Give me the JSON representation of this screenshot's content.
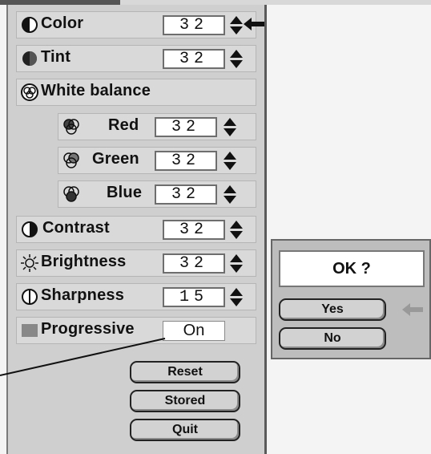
{
  "menu": {
    "color": {
      "label": "Color",
      "value": "32",
      "icon": "color-icon"
    },
    "tint": {
      "label": "Tint",
      "value": "32",
      "icon": "tint-icon"
    },
    "white_balance": {
      "label": "White balance",
      "icon": "white-balance-icon"
    },
    "red": {
      "label": "Red",
      "value": "32",
      "icon": "red-icon"
    },
    "green": {
      "label": "Green",
      "value": "32",
      "icon": "green-icon"
    },
    "blue": {
      "label": "Blue",
      "value": "32",
      "icon": "blue-icon"
    },
    "contrast": {
      "label": "Contrast",
      "value": "32",
      "icon": "contrast-icon"
    },
    "brightness": {
      "label": "Brightness",
      "value": "32",
      "icon": "brightness-icon"
    },
    "sharpness": {
      "label": "Sharpness",
      "value": "15",
      "icon": "sharpness-icon"
    },
    "progressive": {
      "label": "Progressive",
      "value": "On",
      "icon": "progressive-icon"
    }
  },
  "buttons": {
    "reset": "Reset",
    "stored": "Stored",
    "quit": "Quit"
  },
  "dialog": {
    "prompt": "OK ?",
    "yes": "Yes",
    "no": "No"
  },
  "colors": {
    "panel": "#cfcfcf",
    "row": "#d9d9d9",
    "dialog": "#bdbdbd",
    "text": "#111111"
  }
}
